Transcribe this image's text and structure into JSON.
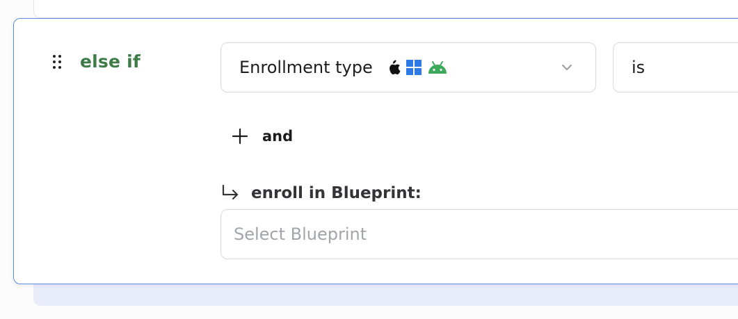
{
  "rule": {
    "condition_keyword": "else if",
    "condition": {
      "field_label": "Enrollment type",
      "platform_icons": [
        "apple-icon",
        "windows-icon",
        "android-icon"
      ],
      "operator": "is"
    },
    "add_condition_label": "and",
    "action": {
      "label": "enroll in Blueprint:",
      "placeholder": "Select Blueprint"
    }
  },
  "colors": {
    "condition_keyword": "#3d7c47",
    "card_border": "#5b8ee0",
    "windows_blue": "#2f7be5",
    "android_green": "#3da95a"
  }
}
